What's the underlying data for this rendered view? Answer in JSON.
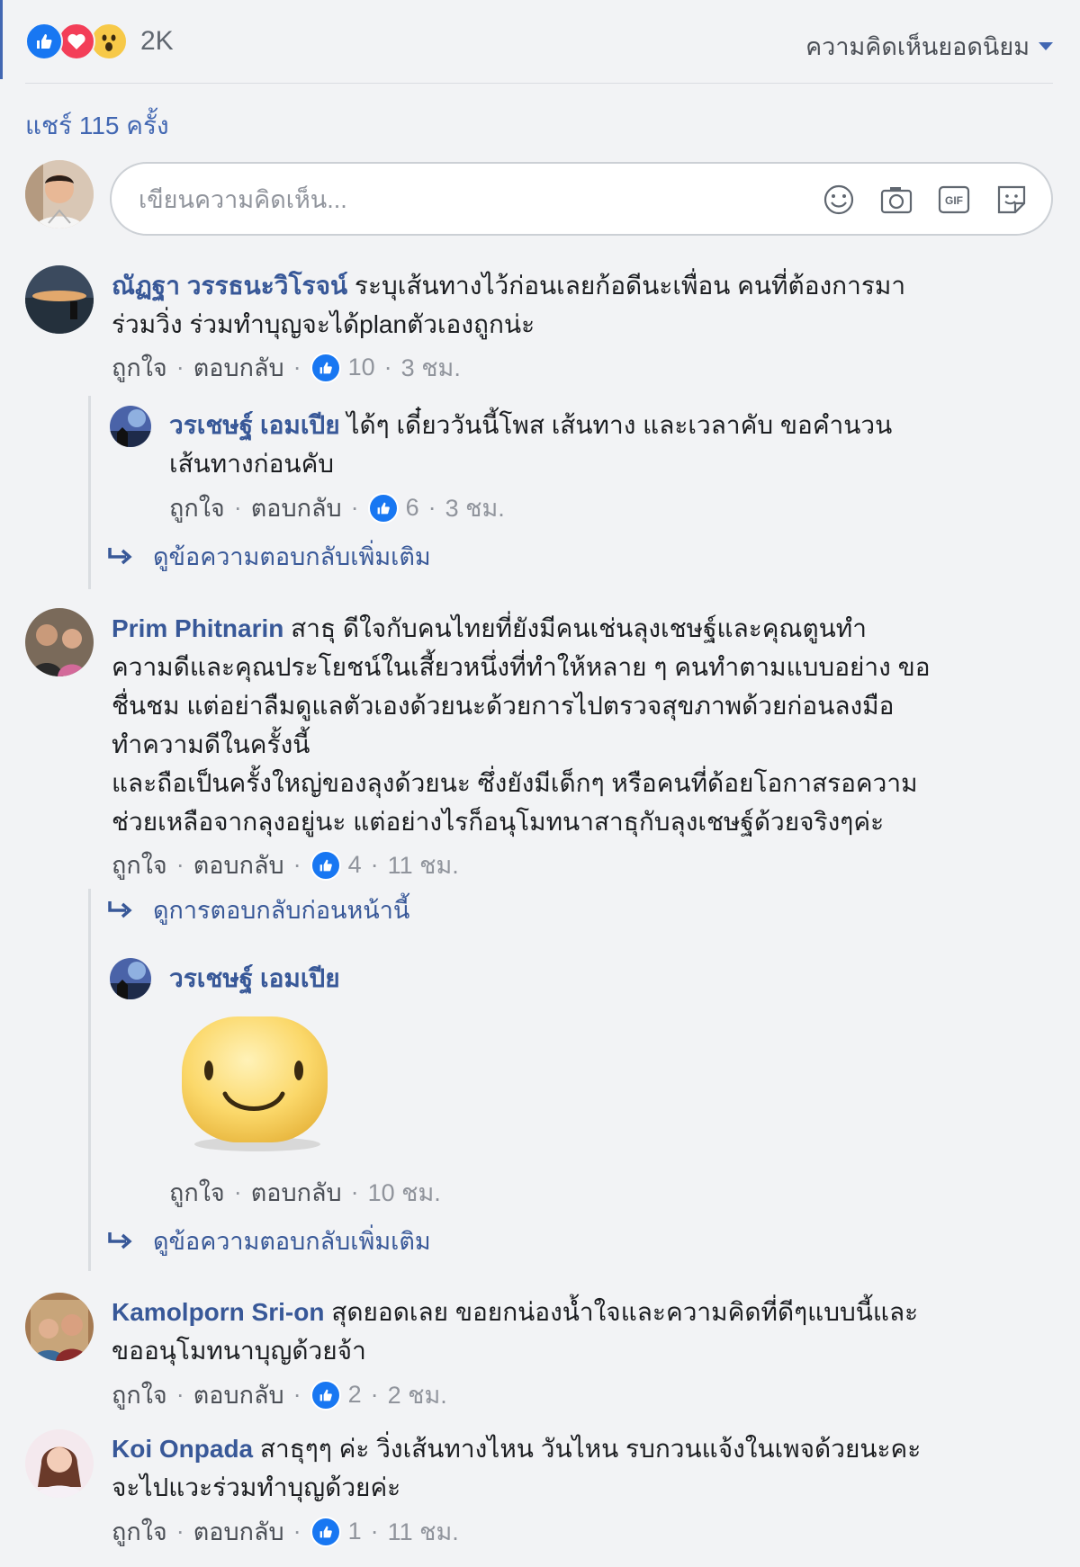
{
  "reactions": {
    "count": "2K",
    "types": [
      "like-icon",
      "love-icon",
      "wow-icon"
    ]
  },
  "sort_label": "ความคิดเห็นยอดนิยม",
  "shares": "แชร์ 115 ครั้ง",
  "composer": {
    "placeholder": "เขียนความคิดเห็น..."
  },
  "actions": {
    "like": "ถูกใจ",
    "reply": "ตอบกลับ",
    "dot": "·"
  },
  "comments": [
    {
      "author": "ณัฏฐา วรรธนะวิโรจน์",
      "text_l1": " ระบุเส้นทางไว้ก่อนเลยก้อดีนะเพื่อน คนที่ต้องการมา",
      "text_l2": "ร่วมวิ่ง ร่วมทำบุญจะได้planตัวเองถูกน่ะ",
      "likes": "10",
      "time": "3 ชม.",
      "reply": {
        "author": "วรเชษฐ์ เอมเปีย",
        "text_l1": " ได้ๆ เดี๋ยววันนี้โพส เส้นทาง และเวลาคับ ขอคำนวน",
        "text_l2": "เส้นทางก่อนคับ",
        "likes": "6",
        "time": "3 ชม."
      },
      "more": "ดูข้อความตอบกลับเพิ่มเติม"
    },
    {
      "author": "Prim Phitnarin",
      "text_l1": " สาธุ ดีใจกับคนไทยที่ยังมีคนเช่นลุงเชษฐ์และคุณตูนทำ",
      "text_l2": "ความดีและคุณประโยชน์ในเสี้ยวหนึ่งที่ทำให้หลาย ๆ คนทำตามแบบอย่าง ขอ",
      "text_l3": "ชื่นชม แต่อย่าลืมดูแลตัวเองด้วยนะด้วยการไปตรวจสุขภาพด้วยก่อนลงมือ",
      "text_l4": "ทำความดีในครั้งนี้",
      "text_l5": "และถือเป็นครั้งใหญ่ของลุงด้วยนะ ซึ่งยังมีเด็กๆ หรือคนที่ด้อยโอกาสรอความ",
      "text_l6": "ช่วยเหลือจากลุงอยู่นะ แต่อย่างไรก็อนุโมทนาสาธุกับลุงเชษฐ์ด้วยจริงๆค่ะ",
      "likes": "4",
      "time": "11 ชม.",
      "previous": "ดูการตอบกลับก่อนหน้านี้",
      "reply": {
        "author": "วรเชษฐ์ เอมเปีย",
        "time": "10 ชม.",
        "sticker": "smiley-sticker-icon"
      },
      "more": "ดูข้อความตอบกลับเพิ่มเติม"
    },
    {
      "author": "Kamolporn Sri-on",
      "text_l1": " สุดยอดเลย ขอยกน่องน้ำใจและความคิดที่ดีๆแบบนี้และ",
      "text_l2": "ขออนุโมทนาบุญด้วยจ้า",
      "likes": "2",
      "time": "2 ชม."
    },
    {
      "author": "Koi Onpada",
      "text_l1": " สาธุๆๆ ค่ะ วิ่งเส้นทางไหน วันไหน รบกวนแจ้งในเพจด้วยนะคะ",
      "text_l2": "จะไปแวะร่วมทำบุญด้วยค่ะ",
      "likes": "1",
      "time": "11 ชม."
    }
  ]
}
